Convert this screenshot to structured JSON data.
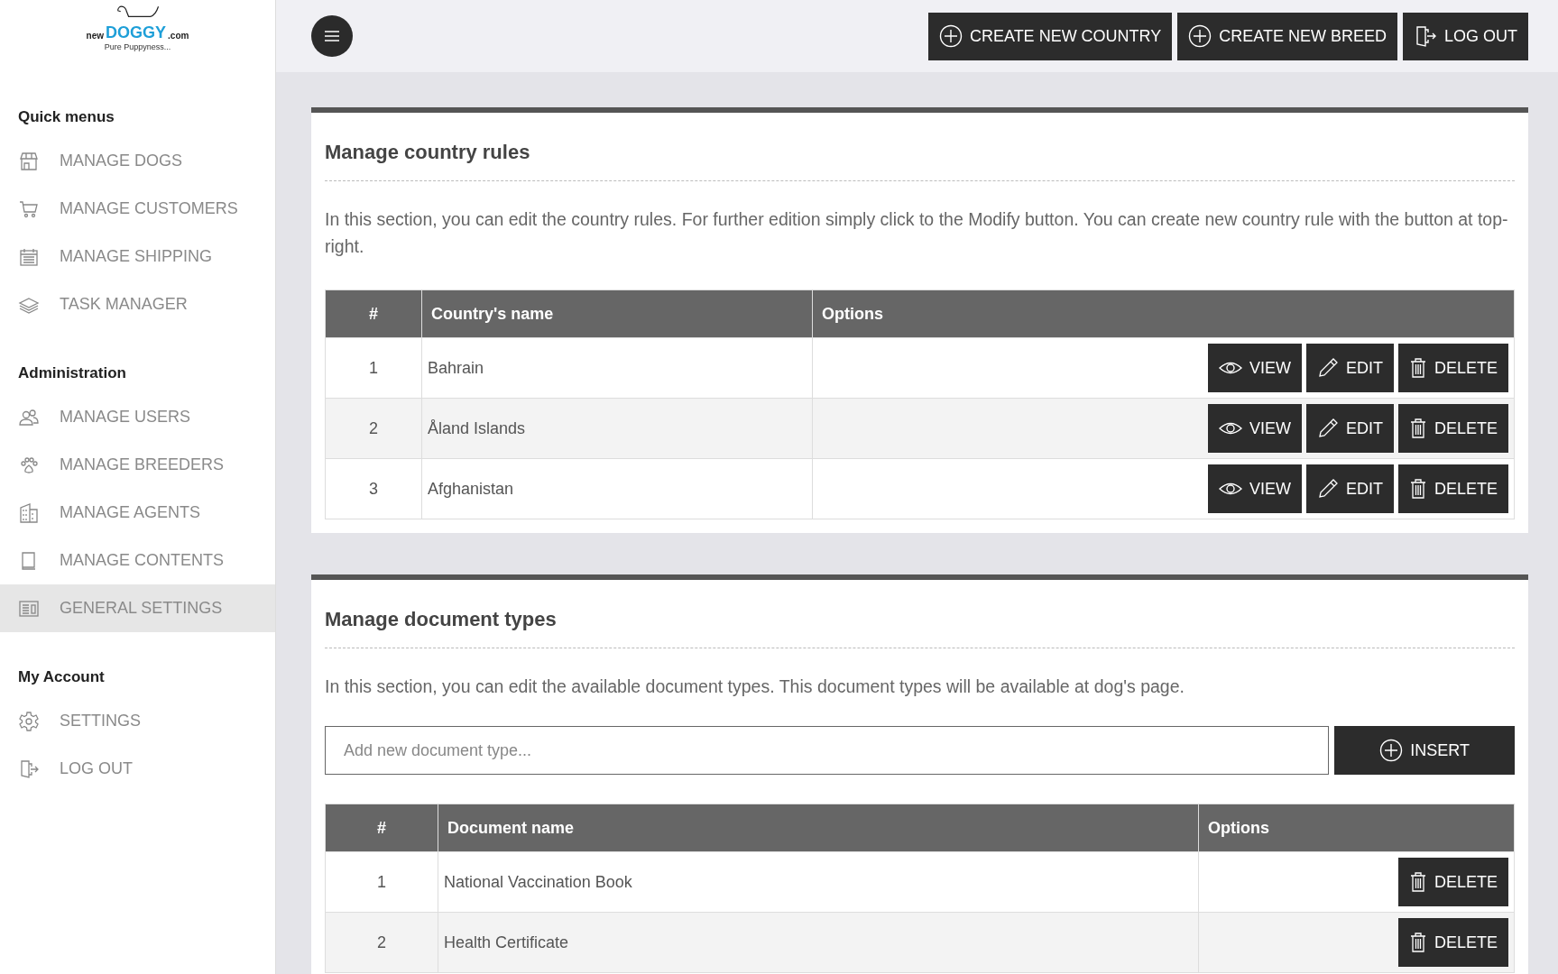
{
  "logo": {
    "word_small": "new",
    "word_main": "DOGGY",
    "suffix": ".com",
    "tagline": "Pure Puppyness..."
  },
  "sidebar": {
    "sections": [
      {
        "heading": "Quick menus",
        "items": [
          {
            "label": "MANAGE DOGS",
            "selected": false
          },
          {
            "label": "MANAGE CUSTOMERS",
            "selected": false
          },
          {
            "label": "MANAGE SHIPPING",
            "selected": false
          },
          {
            "label": "TASK MANAGER",
            "selected": false
          }
        ]
      },
      {
        "heading": "Administration",
        "items": [
          {
            "label": "MANAGE USERS",
            "selected": false
          },
          {
            "label": "MANAGE BREEDERS",
            "selected": false
          },
          {
            "label": "MANAGE AGENTS",
            "selected": false
          },
          {
            "label": "MANAGE CONTENTS",
            "selected": false
          },
          {
            "label": "GENERAL SETTINGS",
            "selected": true
          }
        ]
      },
      {
        "heading": "My Account",
        "items": [
          {
            "label": "SETTINGS",
            "selected": false
          },
          {
            "label": "LOG OUT",
            "selected": false
          }
        ]
      }
    ]
  },
  "topbar": {
    "buttons": [
      {
        "kind": "add",
        "label": "CREATE NEW COUNTRY"
      },
      {
        "kind": "add",
        "label": "CREATE NEW BREED"
      },
      {
        "kind": "logout",
        "label": "LOG OUT"
      }
    ]
  },
  "country_rules": {
    "title": "Manage country rules",
    "description": "In this section, you can edit the country rules. For further edition simply click to the Modify button. You can create new country rule with the button at top-right.",
    "table": {
      "columns": [
        "#",
        "Country's name",
        "Options"
      ],
      "rows": [
        {
          "number": "1",
          "name": "Bahrain",
          "actions": [
            {
              "kind": "view",
              "label": "VIEW"
            },
            {
              "kind": "edit",
              "label": "EDIT"
            },
            {
              "kind": "delete",
              "label": "DELETE"
            }
          ]
        },
        {
          "number": "2",
          "name": "Åland Islands",
          "actions": [
            {
              "kind": "view",
              "label": "VIEW"
            },
            {
              "kind": "edit",
              "label": "EDIT"
            },
            {
              "kind": "delete",
              "label": "DELETE"
            }
          ]
        },
        {
          "number": "3",
          "name": "Afghanistan",
          "actions": [
            {
              "kind": "view",
              "label": "VIEW"
            },
            {
              "kind": "edit",
              "label": "EDIT"
            },
            {
              "kind": "delete",
              "label": "DELETE"
            }
          ]
        }
      ]
    }
  },
  "document_types": {
    "title": "Manage document types",
    "description": "In this section, you can edit the available document types. This document types will be available at dog's page.",
    "input": {
      "placeholder": "Add new document type..."
    },
    "insert_button": {
      "kind": "add",
      "label": "INSERT"
    },
    "table": {
      "columns": [
        "#",
        "Document name",
        "Options"
      ],
      "rows": [
        {
          "number": "1",
          "name": "National Vaccination Book",
          "actions": [
            {
              "kind": "delete",
              "label": "DELETE"
            }
          ]
        },
        {
          "number": "2",
          "name": "Health Certificate",
          "actions": [
            {
              "kind": "delete",
              "label": "DELETE"
            }
          ]
        }
      ]
    }
  }
}
